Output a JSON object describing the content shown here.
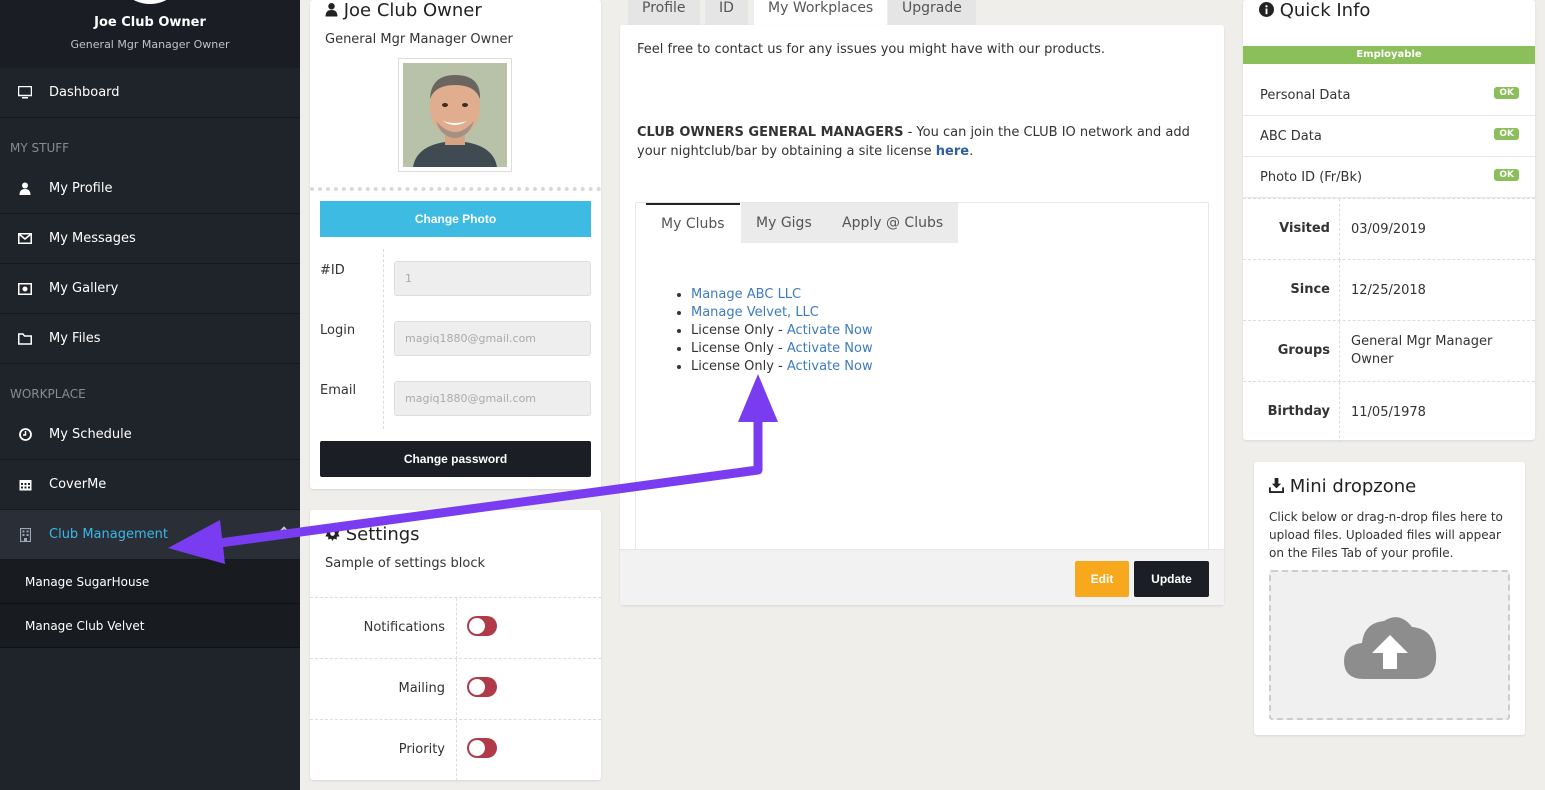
{
  "sidebar": {
    "user_name": "Joe Club Owner",
    "user_role": "General Mgr Manager Owner",
    "dashboard": "Dashboard",
    "section_my_stuff": "MY STUFF",
    "my_profile": "My Profile",
    "my_messages": "My Messages",
    "my_gallery": "My Gallery",
    "my_files": "My Files",
    "section_workplace": "WORKPLACE",
    "my_schedule": "My Schedule",
    "coverme": "CoverMe",
    "club_management": "Club Management",
    "sub_items": [
      "Manage SugarHouse",
      "Manage Club Velvet"
    ]
  },
  "profile": {
    "name": "Joe Club Owner",
    "role": "General Mgr Manager Owner",
    "change_photo": "Change Photo",
    "id_label": "#ID",
    "id_value": "1",
    "login_label": "Login",
    "login_value": "magiq1880@gmail.com",
    "email_label": "Email",
    "email_value": "magiq1880@gmail.com",
    "change_password": "Change password"
  },
  "settings": {
    "title": "Settings",
    "subtitle": "Sample of settings block",
    "rows": [
      "Notifications",
      "Mailing",
      "Priority"
    ]
  },
  "center": {
    "tabs": [
      "Profile",
      "ID",
      "My Workplaces",
      "Upgrade"
    ],
    "intro": "Feel free to contact us for any issues you might have with our products.",
    "club_heading": "CLUB OWNERS GENERAL MANAGERS",
    "club_text": " - You can join the CLUB IO network and add your nightclub/bar by obtaining a site license ",
    "here_link": "here",
    "period": ".",
    "inner_tabs": [
      "My Clubs",
      "My Gigs",
      "Apply @ Clubs"
    ],
    "clubs": {
      "manage_abc": "Manage ABC LLC",
      "manage_velvet": "Manage Velvet, LLC",
      "license_only": "License Only - ",
      "activate_now": "Activate Now"
    },
    "edit": "Edit",
    "update": "Update"
  },
  "quick_info": {
    "title": "Quick Info",
    "status": "Employable",
    "checks": [
      "Personal Data",
      "ABC Data",
      "Photo ID (Fr/Bk)"
    ],
    "ok": "OK",
    "visited_label": "Visited",
    "visited": "03/09/2019",
    "since_label": "Since",
    "since": "12/25/2018",
    "groups_label": "Groups",
    "groups": "General Mgr Manager Owner",
    "birthday_label": "Birthday",
    "birthday": "11/05/1978"
  },
  "dropzone": {
    "title": "Mini dropzone",
    "text": "Click below or drag-n-drop files here to upload files. Uploaded files will appear on the Files Tab of your profile."
  },
  "colors": {
    "accent": "#3ab8e8",
    "annotation_arrow": "#7a3cf0",
    "ok_green": "#8bbf5a",
    "edit_orange": "#f8a81c"
  }
}
